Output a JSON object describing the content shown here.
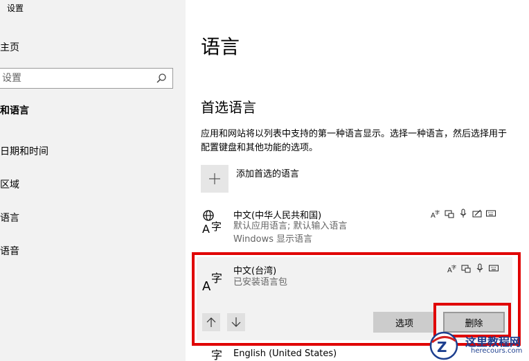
{
  "window": {
    "title": "设置"
  },
  "sidebar": {
    "home": "主页",
    "search_placeholder": "设置",
    "group_header": "和语言",
    "items": [
      {
        "label": "日期和时间"
      },
      {
        "label": "区域"
      },
      {
        "label": "语言"
      },
      {
        "label": "语音"
      }
    ]
  },
  "main": {
    "title": "语言",
    "preferred_section": {
      "title": "首选语言",
      "description": "应用和网站将以列表中支持的第一种语言显示。选择一种语言，然后选择用于配置键盘和其他功能的选项。",
      "add_label": "添加首选的语言"
    },
    "languages": [
      {
        "name": "中文(中华人民共和国)",
        "sub1": "默认应用语言; 默认输入语言",
        "sub2": "Windows 显示语言",
        "features": [
          "language-pack-icon",
          "display-language-icon",
          "speech-icon",
          "handwriting-icon",
          "keyboard-icon"
        ]
      },
      {
        "name": "中文(台湾)",
        "sub1": "已安装语言包",
        "features": [
          "language-pack-icon",
          "display-language-icon",
          "speech-icon",
          "keyboard-icon"
        ],
        "selected": true,
        "options_label": "选项",
        "remove_label": "删除"
      },
      {
        "name": "English (United States)"
      }
    ]
  },
  "watermark": {
    "cn": "这里教程网",
    "en": "herecours.com"
  },
  "colors": {
    "highlight_red": "#e00000",
    "sidebar_bg": "#f2f2f2",
    "watermark_blue": "#1d3f8f"
  }
}
